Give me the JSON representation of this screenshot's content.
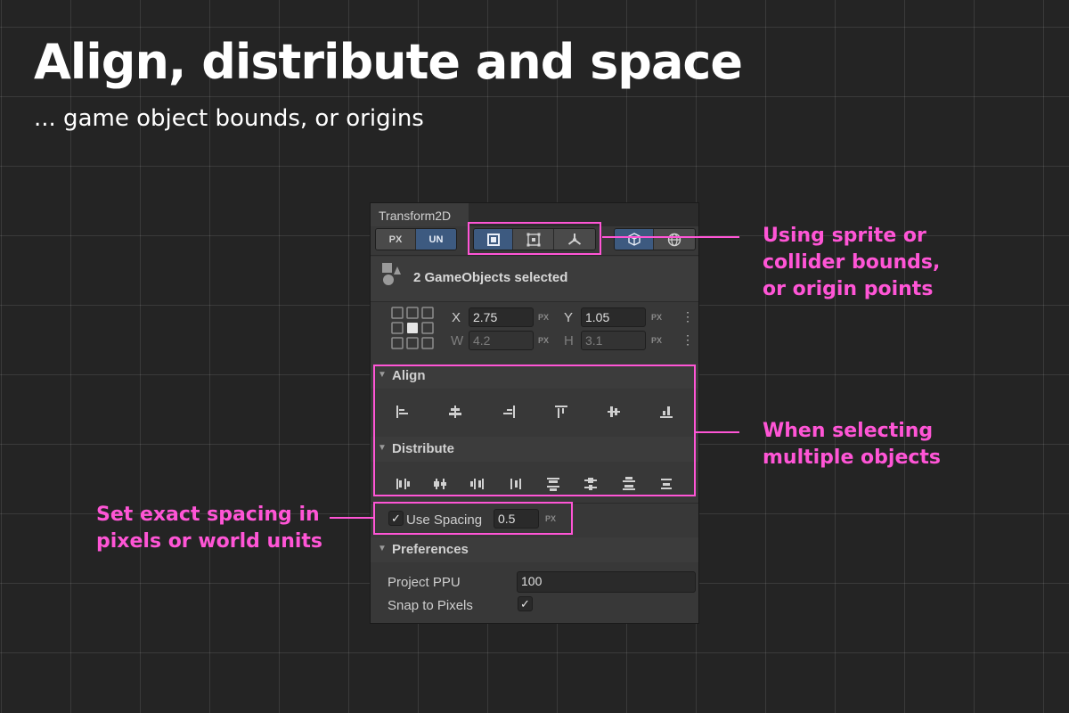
{
  "title": "Align, distribute and space",
  "subtitle": "... game object bounds, or origins",
  "callouts": {
    "bounds": "Using sprite or\ncollider bounds,\nor origin points",
    "multiple": "When selecting\nmultiple objects",
    "spacing": "Set exact spacing in\npixels or world units"
  },
  "accent_color": "#ff55d6",
  "panel": {
    "tab_title": "Transform2D",
    "unit_toggle": [
      "PX",
      "UN"
    ],
    "unit_selected": "UN",
    "mode_icons": [
      "square-bounds-icon",
      "collider-bounds-icon",
      "origin-points-icon"
    ],
    "space_icons": [
      "local-cube-icon",
      "world-globe-icon"
    ],
    "selection_text": "2 GameObjects selected",
    "x_label": "X",
    "x_value": "2.75",
    "x_unit": "PX",
    "y_label": "Y",
    "y_value": "1.05",
    "y_unit": "PX",
    "w_label": "W",
    "w_value": "4.2",
    "w_unit": "PX",
    "h_label": "H",
    "h_value": "3.1",
    "h_unit": "PX",
    "more_icon": "⋮",
    "align_title": "Align",
    "align_icons": [
      "align-left-icon",
      "align-center-horizontal-icon",
      "align-right-icon",
      "align-top-icon",
      "align-middle-vertical-icon",
      "align-bottom-icon"
    ],
    "distribute_title": "Distribute",
    "distribute_icons": [
      "distribute-left-icon",
      "distribute-center-horizontal-icon",
      "distribute-right-icon",
      "distribute-spacing-horizontal-icon",
      "distribute-top-icon",
      "distribute-middle-vertical-icon",
      "distribute-bottom-icon",
      "distribute-spacing-vertical-icon"
    ],
    "use_spacing_label": "Use Spacing",
    "use_spacing_checked": true,
    "spacing_value": "0.5",
    "spacing_unit": "PX",
    "preferences_title": "Preferences",
    "ppu_label": "Project PPU",
    "ppu_value": "100",
    "snap_label": "Snap to Pixels",
    "snap_checked": true,
    "checkmark": "✓"
  }
}
